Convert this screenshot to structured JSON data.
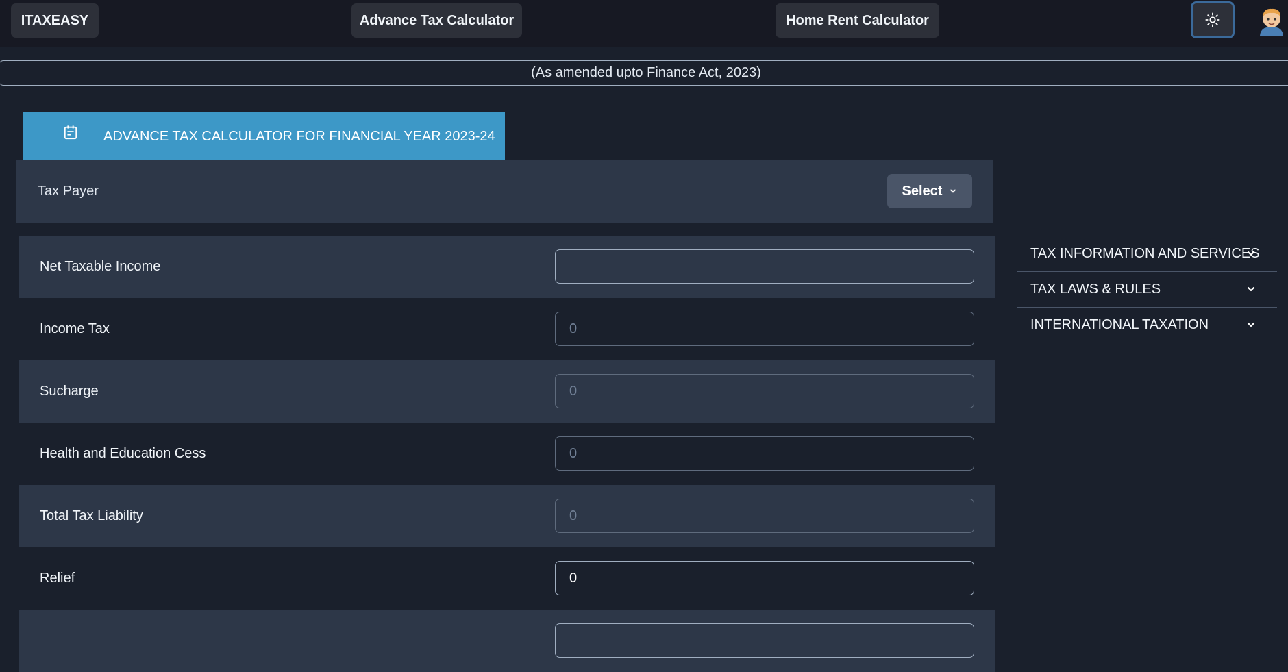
{
  "nav": {
    "brand": "ITAXEASY",
    "advance_tax": "Advance Tax Calculator",
    "home_rent": "Home Rent Calculator"
  },
  "subtitle": "(As amended upto Finance Act, 2023)",
  "calculator": {
    "tab_title": "ADVANCE TAX CALCULATOR FOR FINANCIAL YEAR 2023-24",
    "tax_payer_label": "Tax Payer",
    "select_label": "Select",
    "fields": [
      {
        "label": "Net Taxable Income",
        "value": ""
      },
      {
        "label": "Income Tax",
        "value": "0"
      },
      {
        "label": "Sucharge",
        "value": "0"
      },
      {
        "label": "Health and Education Cess",
        "value": "0"
      },
      {
        "label": "Total Tax Liability",
        "value": "0"
      },
      {
        "label": "Relief",
        "value": "0"
      }
    ]
  },
  "sidebar": {
    "items": [
      "TAX INFORMATION AND SERVICES",
      "TAX LAWS & RULES",
      "INTERNATIONAL TAXATION"
    ]
  },
  "icons": {
    "theme": "sun-icon",
    "avatar": "user-avatar",
    "calendar": "calendar-icon",
    "chevron": "chevron-down-icon"
  },
  "colors": {
    "background": "#1a202c",
    "topbar": "#171923",
    "accent": "#3d98c7",
    "row_shade": "#2d3748"
  }
}
